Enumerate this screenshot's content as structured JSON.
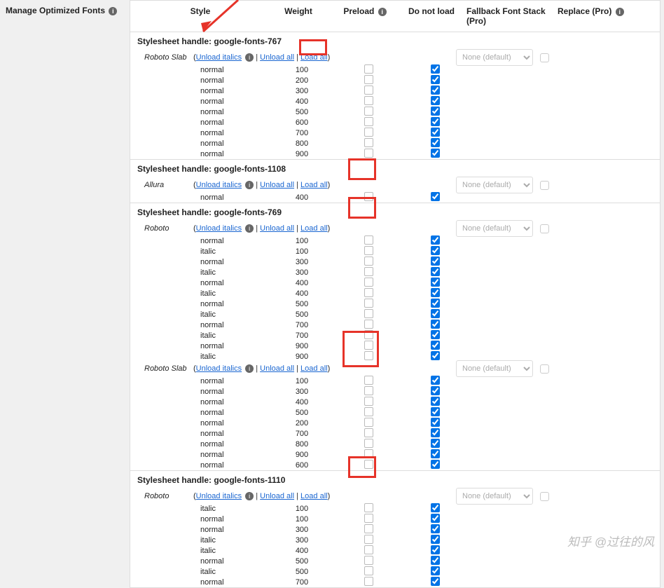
{
  "page_title": "Manage Optimized Fonts",
  "columns": {
    "style": "Style",
    "weight": "Weight",
    "preload": "Preload",
    "notload": "Do not load",
    "fallback": "Fallback Font Stack (Pro)",
    "replace": "Replace (Pro)"
  },
  "actions": {
    "unload_italics": "Unload italics",
    "unload_all": "Unload all",
    "load_all": "Load all"
  },
  "fallback_default": "None (default)",
  "sheets": [
    {
      "handle": "Stylesheet handle: google-fonts-767",
      "families": [
        {
          "name": "Roboto Slab",
          "rows": [
            {
              "style": "normal",
              "weight": "100",
              "preload": false,
              "notload": true
            },
            {
              "style": "normal",
              "weight": "200",
              "preload": false,
              "notload": true
            },
            {
              "style": "normal",
              "weight": "300",
              "preload": false,
              "notload": true
            },
            {
              "style": "normal",
              "weight": "400",
              "preload": false,
              "notload": true
            },
            {
              "style": "normal",
              "weight": "500",
              "preload": false,
              "notload": true
            },
            {
              "style": "normal",
              "weight": "600",
              "preload": false,
              "notload": true
            },
            {
              "style": "normal",
              "weight": "700",
              "preload": false,
              "notload": true
            },
            {
              "style": "normal",
              "weight": "800",
              "preload": false,
              "notload": true
            },
            {
              "style": "normal",
              "weight": "900",
              "preload": false,
              "notload": true
            }
          ]
        }
      ]
    },
    {
      "handle": "Stylesheet handle: google-fonts-1108",
      "families": [
        {
          "name": "Allura",
          "rows": [
            {
              "style": "normal",
              "weight": "400",
              "preload": false,
              "notload": true
            }
          ]
        }
      ]
    },
    {
      "handle": "Stylesheet handle: google-fonts-769",
      "families": [
        {
          "name": "Roboto",
          "rows": [
            {
              "style": "normal",
              "weight": "100",
              "preload": false,
              "notload": true
            },
            {
              "style": "italic",
              "weight": "100",
              "preload": false,
              "notload": true
            },
            {
              "style": "normal",
              "weight": "300",
              "preload": false,
              "notload": true
            },
            {
              "style": "italic",
              "weight": "300",
              "preload": false,
              "notload": true
            },
            {
              "style": "normal",
              "weight": "400",
              "preload": false,
              "notload": true
            },
            {
              "style": "italic",
              "weight": "400",
              "preload": false,
              "notload": true
            },
            {
              "style": "normal",
              "weight": "500",
              "preload": false,
              "notload": true
            },
            {
              "style": "italic",
              "weight": "500",
              "preload": false,
              "notload": true
            },
            {
              "style": "normal",
              "weight": "700",
              "preload": false,
              "notload": true
            },
            {
              "style": "italic",
              "weight": "700",
              "preload": false,
              "notload": true
            },
            {
              "style": "normal",
              "weight": "900",
              "preload": false,
              "notload": true
            },
            {
              "style": "italic",
              "weight": "900",
              "preload": false,
              "notload": true
            }
          ]
        },
        {
          "name": "Roboto Slab",
          "rows": [
            {
              "style": "normal",
              "weight": "100",
              "preload": false,
              "notload": true
            },
            {
              "style": "normal",
              "weight": "300",
              "preload": false,
              "notload": true
            },
            {
              "style": "normal",
              "weight": "400",
              "preload": false,
              "notload": true
            },
            {
              "style": "normal",
              "weight": "500",
              "preload": false,
              "notload": true
            },
            {
              "style": "normal",
              "weight": "200",
              "preload": false,
              "notload": true
            },
            {
              "style": "normal",
              "weight": "700",
              "preload": false,
              "notload": true
            },
            {
              "style": "normal",
              "weight": "800",
              "preload": false,
              "notload": true
            },
            {
              "style": "normal",
              "weight": "900",
              "preload": false,
              "notload": true
            },
            {
              "style": "normal",
              "weight": "600",
              "preload": false,
              "notload": true
            }
          ]
        }
      ]
    },
    {
      "handle": "Stylesheet handle: google-fonts-1110",
      "families": [
        {
          "name": "Roboto",
          "rows": [
            {
              "style": "italic",
              "weight": "100",
              "preload": false,
              "notload": true
            },
            {
              "style": "normal",
              "weight": "100",
              "preload": false,
              "notload": true
            },
            {
              "style": "normal",
              "weight": "300",
              "preload": false,
              "notload": true
            },
            {
              "style": "italic",
              "weight": "300",
              "preload": false,
              "notload": true
            },
            {
              "style": "italic",
              "weight": "400",
              "preload": false,
              "notload": true
            },
            {
              "style": "normal",
              "weight": "500",
              "preload": false,
              "notload": true
            },
            {
              "style": "italic",
              "weight": "500",
              "preload": false,
              "notload": true
            },
            {
              "style": "normal",
              "weight": "700",
              "preload": false,
              "notload": true
            }
          ]
        }
      ]
    }
  ],
  "watermark": "知乎 @过往的风"
}
